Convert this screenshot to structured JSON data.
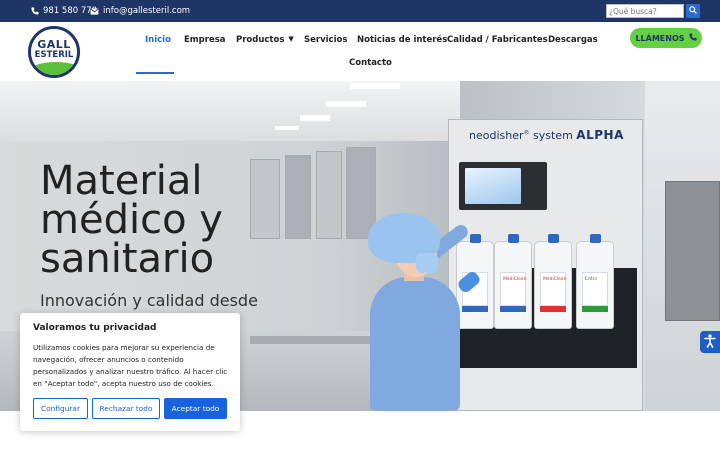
{
  "topbar": {
    "phone": "981 580 770",
    "email": "info@gallesteril.com",
    "search_placeholder": "¿Qué busca?"
  },
  "logo": {
    "line1": "GALL",
    "line2": "ESTERIL"
  },
  "nav": {
    "items": [
      "Inicio",
      "Empresa",
      "Productos",
      "Servicios",
      "Noticias de interés",
      "Calidad / Fabricantes",
      "Descargas",
      "Contacto"
    ],
    "active": "Inicio"
  },
  "call_button": {
    "label": "LLÁMENOS"
  },
  "hero": {
    "machine_brand": "neodisher",
    "machine_system": "system",
    "machine_model": "ALPHA",
    "title_lines": [
      "Material",
      "médico y",
      "sanitario"
    ],
    "subtitle": "Innovación y calidad desde",
    "bottle_labels": [
      "MediClean",
      "MediClean",
      "Entro",
      "Entro"
    ]
  },
  "cookie_banner": {
    "title": "Valoramos tu privacidad",
    "text": "Utilizamos cookies para mejorar su experiencia de navegación, ofrecer anuncios o contenido personalizados y analizar nuestro tráfico. Al hacer clic en \"Aceptar todo\", acepta nuestro uso de cookies.",
    "customize_label": "Configurar",
    "reject_label": "Rechazar todo",
    "accept_label": "Aceptar todo"
  },
  "colors": {
    "topbar": "#1e3566",
    "accent_blue": "#2a6bd1",
    "call_green": "#65cf45",
    "cookie_blue": "#1863dc"
  },
  "icons": [
    "phone-icon",
    "envelope-icon",
    "search-icon",
    "phone-icon",
    "accessibility-icon"
  ]
}
